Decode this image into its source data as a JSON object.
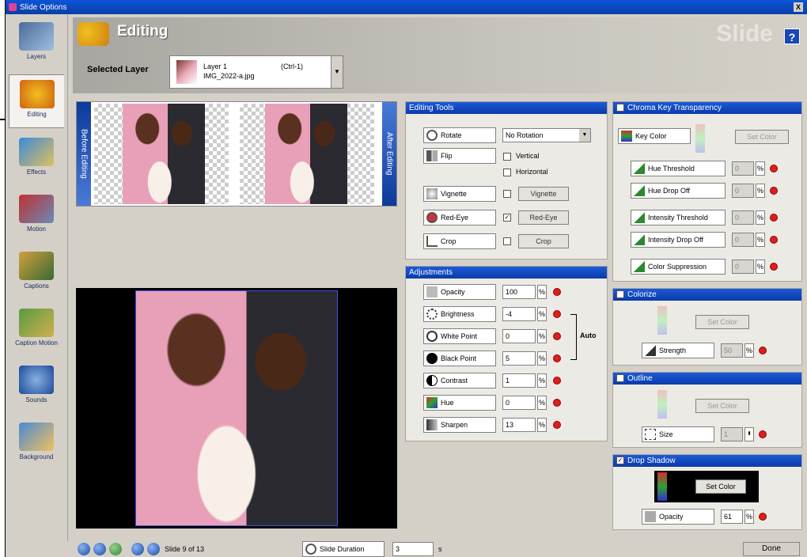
{
  "window": {
    "title": "Slide Options",
    "close_label": "X"
  },
  "sidebar": {
    "items": [
      {
        "label": "Layers",
        "icon": "layers-icon"
      },
      {
        "label": "Editing",
        "icon": "editing-icon",
        "active": true
      },
      {
        "label": "Effects",
        "icon": "effects-icon"
      },
      {
        "label": "Motion",
        "icon": "motion-icon"
      },
      {
        "label": "Captions",
        "icon": "captions-icon"
      },
      {
        "label": "Caption Motion",
        "icon": "caption-motion-icon"
      },
      {
        "label": "Sounds",
        "icon": "sounds-icon"
      },
      {
        "label": "Background",
        "icon": "background-icon"
      }
    ]
  },
  "header": {
    "title": "Editing",
    "brand": "Slide",
    "help_label": "?"
  },
  "selected_layer": {
    "label": "Selected Layer",
    "name": "Layer 1",
    "file": "IMG_2022-a.jpg",
    "shortcut": "(Ctrl-1)"
  },
  "preview": {
    "before_label": "Before Editing",
    "after_label": "After Editing"
  },
  "editing_tools": {
    "title": "Editing Tools",
    "rotate_label": "Rotate",
    "rotate_value": "No Rotation",
    "flip_label": "Flip",
    "vertical_label": "Vertical",
    "horizontal_label": "Horizontal",
    "vignette_label": "Vignette",
    "vignette_button": "Vignette",
    "redeye_label": "Red-Eye",
    "redeye_button": "Red-Eye",
    "crop_label": "Crop",
    "crop_button": "Crop"
  },
  "adjustments": {
    "title": "Adjustments",
    "rows": [
      {
        "label": "Opacity",
        "value": "100"
      },
      {
        "label": "Brightness",
        "value": "-4"
      },
      {
        "label": "White Point",
        "value": "0"
      },
      {
        "label": "Black Point",
        "value": "5"
      },
      {
        "label": "Contrast",
        "value": "1"
      },
      {
        "label": "Hue",
        "value": "0"
      },
      {
        "label": "Sharpen",
        "value": "13"
      }
    ],
    "pct": "%",
    "auto_label": "Auto"
  },
  "chroma": {
    "title": "Chroma Key Transparency",
    "key_color_label": "Key Color",
    "set_color": "Set Color",
    "rows": [
      {
        "label": "Hue Threshold",
        "value": "0"
      },
      {
        "label": "Hue Drop Off",
        "value": "0"
      },
      {
        "label": "Intensity Threshold",
        "value": "0"
      },
      {
        "label": "Intensity Drop Off",
        "value": "0"
      },
      {
        "label": "Color Suppression",
        "value": "0"
      }
    ],
    "pct": "%"
  },
  "colorize": {
    "title": "Colorize",
    "set_color": "Set Color",
    "strength_label": "Strength",
    "strength_value": "50",
    "pct": "%"
  },
  "outline": {
    "title": "Outline",
    "set_color": "Set Color",
    "size_label": "Size",
    "size_value": "1"
  },
  "drop_shadow": {
    "title": "Drop Shadow",
    "set_color": "Set Color",
    "opacity_label": "Opacity",
    "opacity_value": "61",
    "pct": "%"
  },
  "bottom": {
    "slide_text": "Slide 9 of 13",
    "duration_label": "Slide Duration",
    "duration_value": "3",
    "duration_unit": "s",
    "done_label": "Done"
  }
}
